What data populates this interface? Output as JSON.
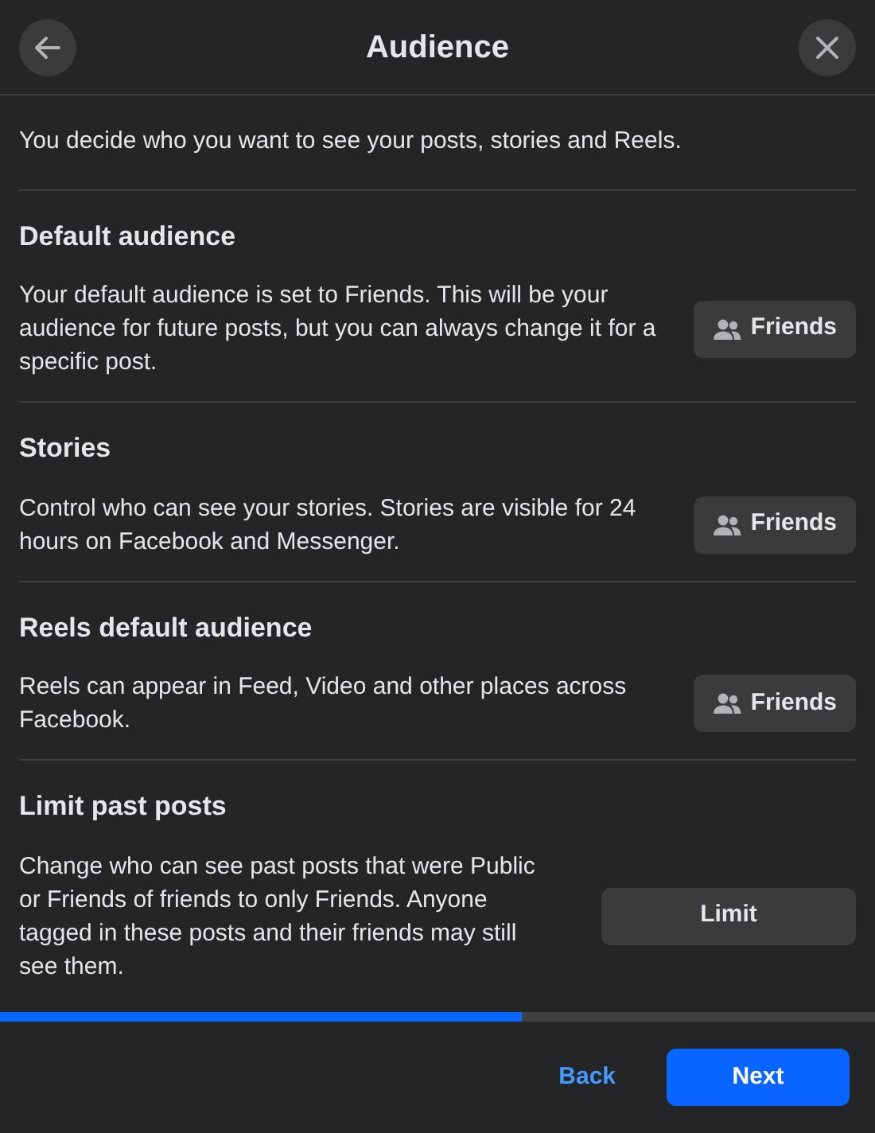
{
  "header": {
    "title": "Audience"
  },
  "intro": "You decide who you want to see your posts, stories and Reels.",
  "sections": [
    {
      "title": "Default audience",
      "description": "Your default audience is set to Friends. This will be your audience for future posts, but you can always change it for a specific post.",
      "button": {
        "label": "Friends",
        "kind": "audience"
      }
    },
    {
      "title": "Stories",
      "description": "Control who can see your stories. Stories are visible for 24 hours on Facebook and Messenger.",
      "button": {
        "label": "Friends",
        "kind": "audience"
      }
    },
    {
      "title": "Reels default audience",
      "description": "Reels can appear in Feed, Video and other places across Facebook.",
      "button": {
        "label": "Friends",
        "kind": "audience"
      }
    },
    {
      "title": "Limit past posts",
      "description": "Change who can see past posts that were Public or Friends of friends to only Friends. Anyone tagged in these posts and their friends may still see them.",
      "button": {
        "label": "Limit",
        "kind": "plain"
      }
    }
  ],
  "progress": {
    "level": 0.597
  },
  "footer": {
    "back": "Back",
    "next": "Next"
  }
}
